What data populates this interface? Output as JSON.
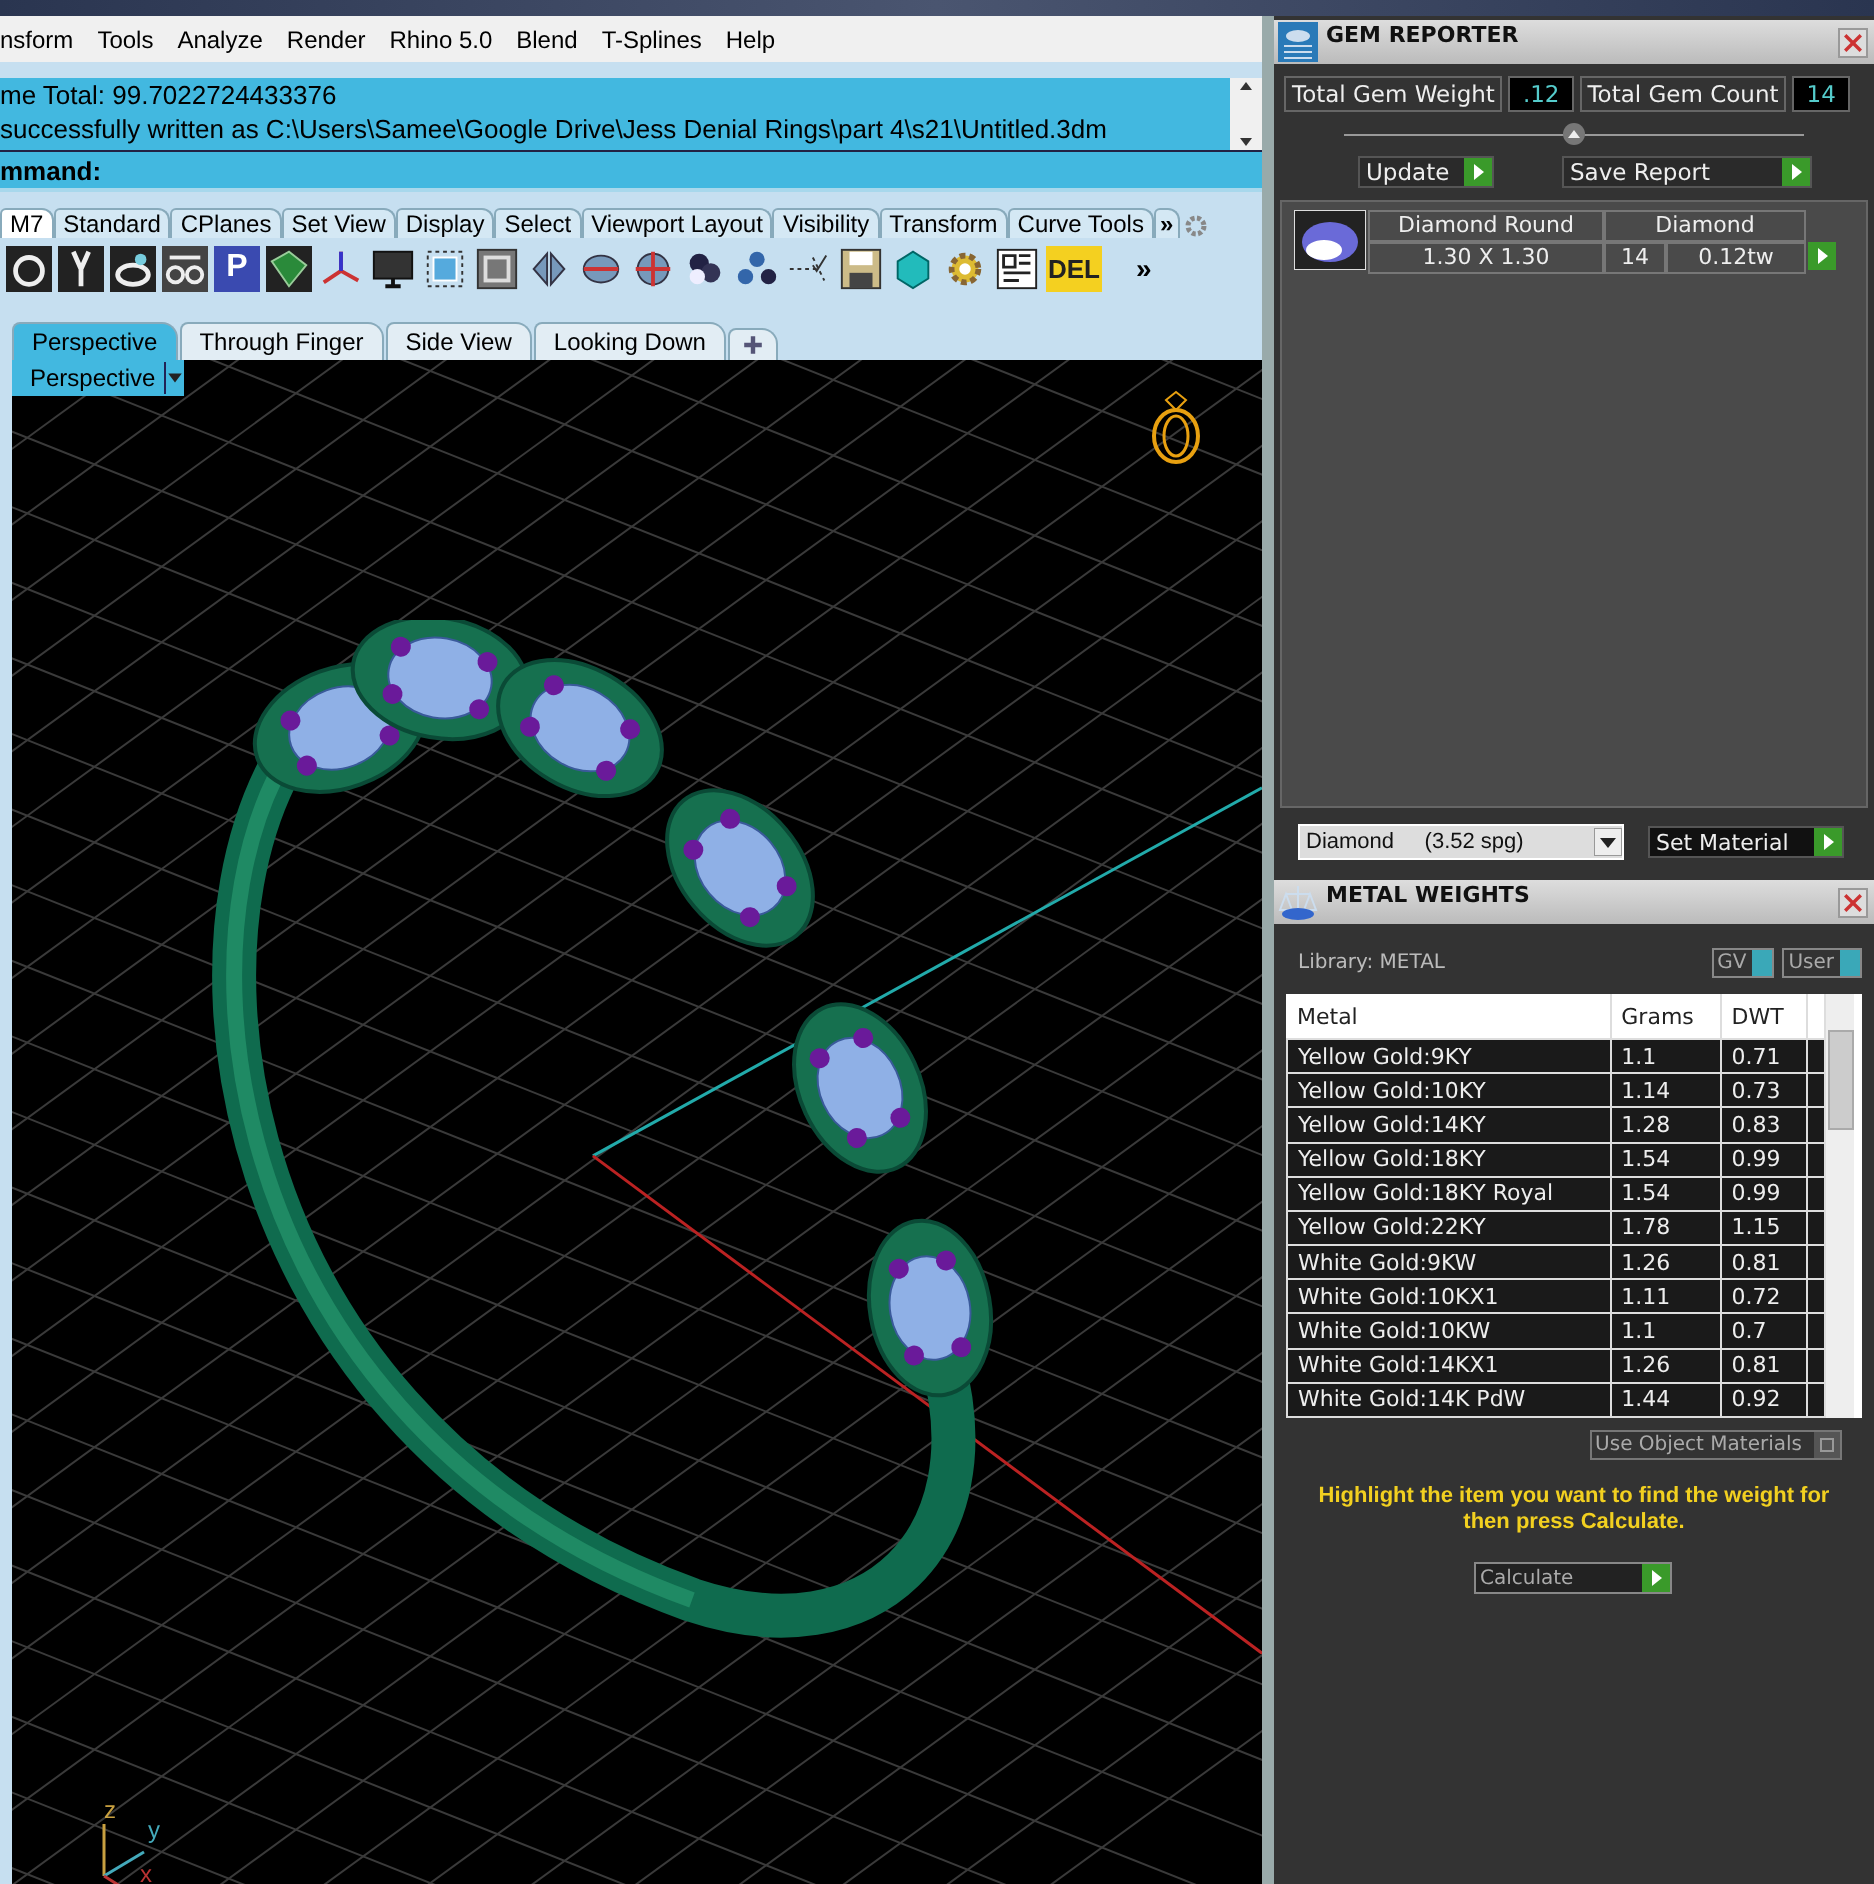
{
  "menu_bar": {
    "items": [
      "nsform",
      "Tools",
      "Analyze",
      "Render",
      "Rhino 5.0",
      "Blend",
      "T-Splines",
      "Help"
    ]
  },
  "command_history": {
    "lines": [
      "me Total: 99.7022724433376",
      "successfully written as C:\\Users\\Samee\\Google Drive\\Jess Denial Rings\\part 4\\s21\\Untitled.3dm"
    ]
  },
  "command_prompt": {
    "label": "mmand:"
  },
  "toolbar_tabs": [
    {
      "label": "M7",
      "selected": true
    },
    {
      "label": "Standard",
      "selected": false
    },
    {
      "label": "CPlanes",
      "selected": false
    },
    {
      "label": "Set View",
      "selected": false
    },
    {
      "label": "Display",
      "selected": false
    },
    {
      "label": "Select",
      "selected": false
    },
    {
      "label": "Viewport Layout",
      "selected": false
    },
    {
      "label": "Visibility",
      "selected": false
    },
    {
      "label": "Transform",
      "selected": false
    },
    {
      "label": "Curve Tools",
      "selected": false
    }
  ],
  "toolbar_tabs_overflow": "»",
  "toolbar_icons": [
    {
      "kind": "ring"
    },
    {
      "kind": "pendant"
    },
    {
      "kind": "ring-gem"
    },
    {
      "kind": "rings"
    },
    {
      "kind": "letter",
      "label": "P"
    },
    {
      "kind": "surface"
    },
    {
      "kind": "gumball"
    },
    {
      "kind": "monitor"
    },
    {
      "kind": "cube"
    },
    {
      "kind": "frame"
    },
    {
      "kind": "split"
    },
    {
      "kind": "disc"
    },
    {
      "kind": "cross"
    },
    {
      "kind": "dots-dark"
    },
    {
      "kind": "dots-blue"
    },
    {
      "kind": "points"
    },
    {
      "kind": "save"
    },
    {
      "kind": "box"
    },
    {
      "kind": "gear"
    },
    {
      "kind": "layout"
    },
    {
      "kind": "letter",
      "label": "DEL"
    }
  ],
  "toolbar_overflow": "»",
  "viewport_tabs": [
    {
      "label": "Perspective",
      "selected": true
    },
    {
      "label": "Through Finger",
      "selected": false
    },
    {
      "label": "Side View",
      "selected": false
    },
    {
      "label": "Looking Down",
      "selected": false
    }
  ],
  "viewport": {
    "name": "Perspective",
    "axes": [
      "z",
      "y",
      "x"
    ]
  },
  "gem_reporter": {
    "title": "GEM REPORTER",
    "total_weight": {
      "label": "Total Gem Weight",
      "value": ".12"
    },
    "total_count": {
      "label": "Total Gem Count",
      "value": "14"
    },
    "buttons": [
      "Update",
      "Save Report"
    ],
    "gems": [
      {
        "name": "Diamond Round",
        "material": "Diamond",
        "size": "1.30 X 1.30",
        "count": "14",
        "weight": "0.12tw"
      }
    ],
    "material": "Diamond     (3.52 spg)",
    "set_button": "Set Material"
  },
  "metal_weights": {
    "title": "METAL WEIGHTS",
    "library": "Library: METAL",
    "toggles": [
      {
        "label": "GV",
        "on": true
      },
      {
        "label": "User",
        "on": true
      }
    ],
    "columns": [
      "Metal",
      "Grams",
      "DWT"
    ],
    "rows": [
      [
        "Yellow Gold:9KY",
        "1.1",
        "0.71"
      ],
      [
        "Yellow Gold:10KY",
        "1.14",
        "0.73"
      ],
      [
        "Yellow Gold:14KY",
        "1.28",
        "0.83"
      ],
      [
        "Yellow Gold:18KY",
        "1.54",
        "0.99"
      ],
      [
        "Yellow Gold:18KY Royal",
        "1.54",
        "0.99"
      ],
      [
        "Yellow Gold:22KY",
        "1.78",
        "1.15"
      ],
      [
        "White Gold:9KW",
        "1.26",
        "0.81"
      ],
      [
        "White Gold:10KX1",
        "1.11",
        "0.72"
      ],
      [
        "White Gold:10KW",
        "1.1",
        "0.7"
      ],
      [
        "White Gold:14KX1",
        "1.26",
        "0.81"
      ],
      [
        "White Gold:14K PdW",
        "1.44",
        "0.92"
      ]
    ],
    "use_object_materials": {
      "label": "Use Object Materials",
      "on": false
    },
    "hint": "Highlight the item you want to find the weight for then press Calculate.",
    "calculate": "Calculate"
  }
}
